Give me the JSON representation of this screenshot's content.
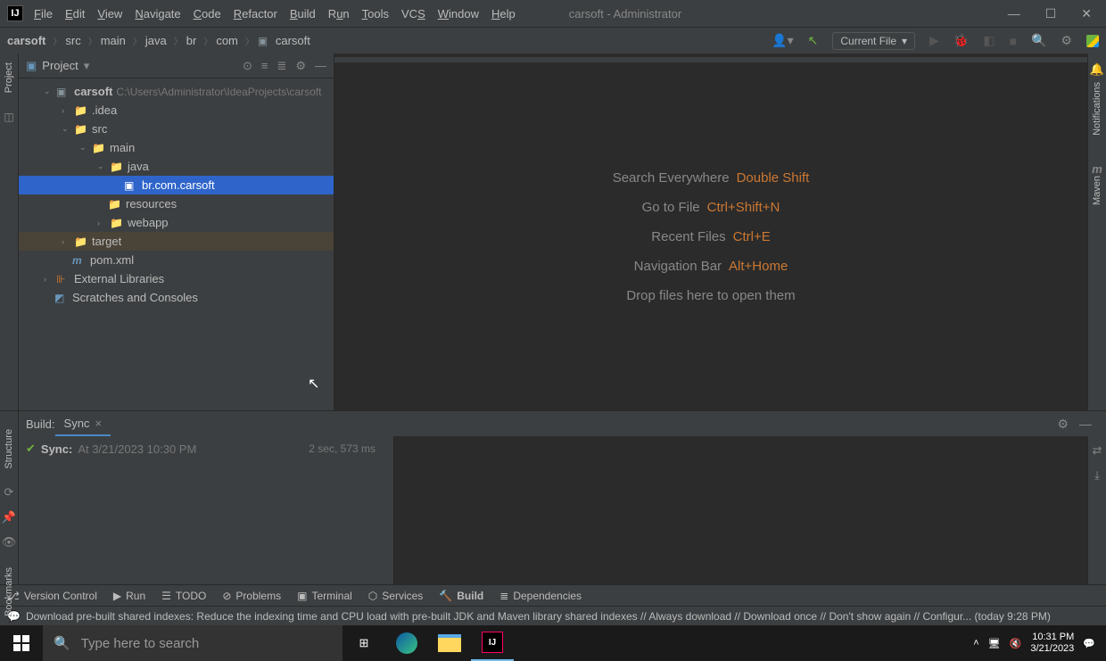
{
  "window": {
    "title": "carsoft - Administrator"
  },
  "menu": [
    "File",
    "Edit",
    "View",
    "Navigate",
    "Code",
    "Refactor",
    "Build",
    "Run",
    "Tools",
    "VCS",
    "Window",
    "Help"
  ],
  "breadcrumbs": [
    "carsoft",
    "src",
    "main",
    "java",
    "br",
    "com",
    "carsoft"
  ],
  "runConfig": "Current File",
  "project": {
    "panelLabel": "Project",
    "root": {
      "name": "carsoft",
      "path": "C:\\Users\\Administrator\\IdeaProjects\\carsoft"
    },
    "items": [
      {
        "name": ".idea",
        "indent": 48
      },
      {
        "name": "src",
        "indent": 48
      },
      {
        "name": "main",
        "indent": 68
      },
      {
        "name": "java",
        "indent": 88
      },
      {
        "name": "br.com.carsoft",
        "indent": 108,
        "selected": true
      },
      {
        "name": "resources",
        "indent": 88
      },
      {
        "name": "webapp",
        "indent": 88
      },
      {
        "name": "target",
        "indent": 48,
        "highlight": true,
        "orange": true
      },
      {
        "name": "pom.xml",
        "indent": 48,
        "maven": true
      },
      {
        "name": "External Libraries",
        "indent": 28
      },
      {
        "name": "Scratches and Consoles",
        "indent": 28
      }
    ]
  },
  "hints": [
    {
      "label": "Search Everywhere",
      "key": "Double Shift"
    },
    {
      "label": "Go to File",
      "key": "Ctrl+Shift+N"
    },
    {
      "label": "Recent Files",
      "key": "Ctrl+E"
    },
    {
      "label": "Navigation Bar",
      "key": "Alt+Home"
    },
    {
      "label": "Drop files here to open them",
      "key": ""
    }
  ],
  "build": {
    "label": "Build:",
    "tab": "Sync",
    "syncLabel": "Sync:",
    "syncTime": "At 3/21/2023 10:30 PM",
    "duration": "2 sec, 573 ms"
  },
  "bottomTabs": [
    "Version Control",
    "Run",
    "TODO",
    "Problems",
    "Terminal",
    "Services",
    "Build",
    "Dependencies"
  ],
  "statusMessage": "Download pre-built shared indexes: Reduce the indexing time and CPU load with pre-built JDK and Maven library shared indexes // Always download // Download once // Don't show again // Configur... (today 9:28 PM)",
  "leftGutter": {
    "project": "Project",
    "structure": "Structure",
    "bookmarks": "Bookmarks"
  },
  "rightGutter": {
    "notifications": "Notifications",
    "maven": "Maven"
  },
  "taskbar": {
    "searchPlaceholder": "Type here to search",
    "time": "10:31 PM",
    "date": "3/21/2023"
  }
}
